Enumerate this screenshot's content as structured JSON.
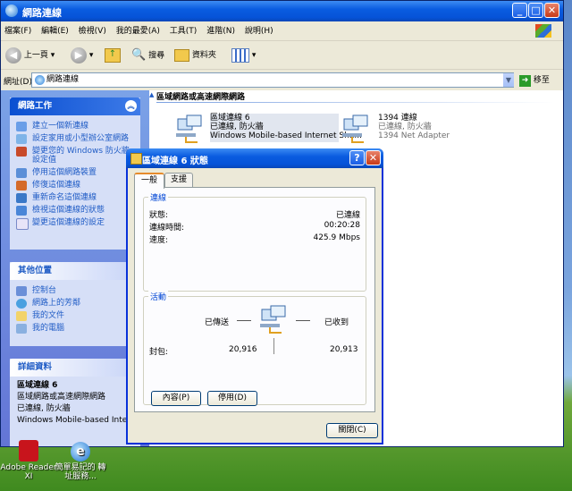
{
  "window": {
    "title": "網路連線",
    "menu": [
      "檔案(F)",
      "編輯(E)",
      "檢視(V)",
      "我的最愛(A)",
      "工具(T)",
      "進階(N)",
      "說明(H)"
    ],
    "toolbar": {
      "back": "上一頁",
      "search": "搜尋",
      "folders": "資料夾"
    },
    "address_label": "網址(D)",
    "address_value": "網路連線",
    "go_label": "移至"
  },
  "sidebar": {
    "network_tasks": {
      "title": "網路工作",
      "items": [
        "建立一個新連線",
        "設定家用或小型辦公室網路",
        "變更您的 Windows 防火牆設定值",
        "停用這個網路裝置",
        "修復這個連線",
        "重新命名這個連線",
        "檢視這個連線的狀態",
        "變更這個連線的設定"
      ]
    },
    "other_places": {
      "title": "其他位置",
      "items": [
        "控制台",
        "網路上的芳鄰",
        "我的文件",
        "我的電腦"
      ]
    },
    "details": {
      "title": "詳細資料",
      "lines": [
        "區域連線 6",
        "區域網路或高速網際網路",
        "已連線, 防火牆",
        "Windows Mobile-based Internet"
      ]
    }
  },
  "content": {
    "group_header": "區域網路或高速網際網路",
    "connections": [
      {
        "name": "區域連線 6",
        "status": "已連線, 防火牆",
        "device": "Windows Mobile-based Internet Sha..."
      },
      {
        "name": "1394 連線",
        "status": "已連線, 防火牆",
        "device": "1394 Net Adapter"
      }
    ]
  },
  "dialog": {
    "title": "區域連線 6 狀態",
    "tabs": [
      "一般",
      "支援"
    ],
    "connection_group": "連線",
    "rows": [
      {
        "label": "狀態:",
        "value": "已連線"
      },
      {
        "label": "連線時間:",
        "value": "00:20:28"
      },
      {
        "label": "速度:",
        "value": "425.9 Mbps"
      }
    ],
    "activity_group": "活動",
    "sent_label": "已傳送",
    "received_label": "已收到",
    "packets_label": "封包:",
    "packets_sent": "20,916",
    "packets_received": "20,913",
    "properties_button": "內容(P)",
    "disable_button": "停用(D)",
    "close_button": "關閉(C)"
  },
  "desktop": {
    "icons": [
      "Adobe Reader XI",
      "簡單易記的 轉址服務..."
    ]
  }
}
